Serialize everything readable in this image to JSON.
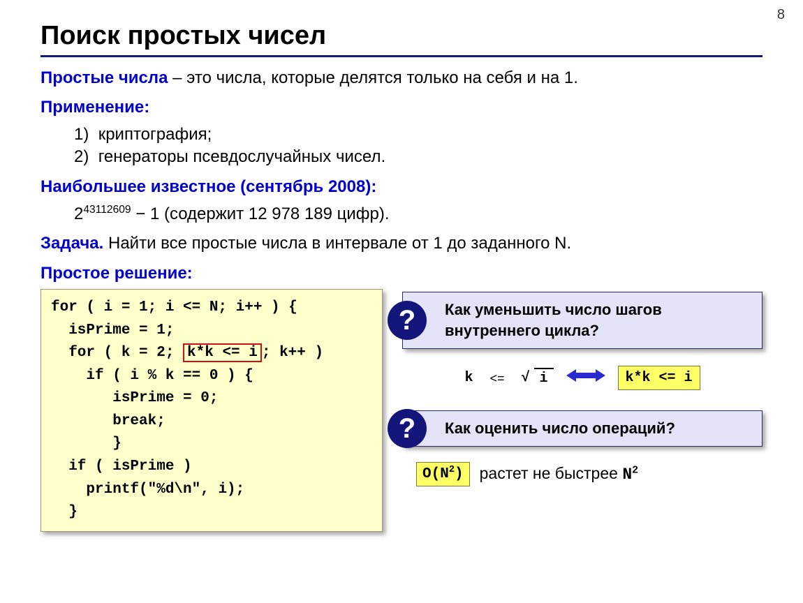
{
  "pageNumber": "8",
  "title": "Поиск простых чисел",
  "def_term": "Простые числа",
  "def_rest": " – это числа, которые делятся только на себя и на 1.",
  "app_head": "Применение:",
  "app1_num": "1)",
  "app1_txt": "криптография;",
  "app2_num": "2)",
  "app2_txt": "генераторы псевдослучайных чисел.",
  "largest_head": "Наибольшее известное (сентябрь 2008):",
  "largest_base": "2",
  "largest_exp": "43112609",
  "largest_rest": " − 1 (содержит 12 978 189 цифр).",
  "task_head": "Задача.",
  "task_rest": " Найти все простые числа в интервале от 1 до заданного N.",
  "solution_head": "Простое решение:",
  "code": {
    "l1": "for ( i = 1; i <= N; i++ ) {",
    "l2": "  isPrime = 1;",
    "l3a": "  for ( k = 2; ",
    "l3h": "k*k <= i",
    "l3b": "; k++ )",
    "l4": "    if ( i % k == 0 ) {",
    "l5": "       isPrime = 0;",
    "l6": "       break;",
    "l7": "       }",
    "l8": "  if ( isPrime )",
    "l9": "    printf(\"%d\\n\", i);",
    "l10": "  }"
  },
  "q1": "Как уменьшить число шагов внутреннего цикла?",
  "q2": "Как оценить число операций?",
  "equiv": {
    "k": "k",
    "le": "<=",
    "i": "i",
    "rhs": "k*k <= i"
  },
  "bigO": {
    "O": "O(N",
    "exp": "2",
    "close": ")",
    "text": "растет не быстрее ",
    "N": "N",
    "Nexp": "2"
  }
}
